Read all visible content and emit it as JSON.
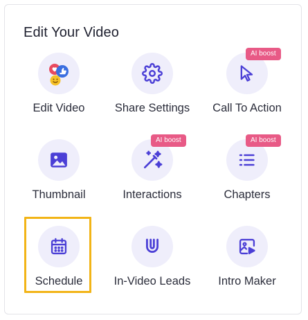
{
  "panel": {
    "title": "Edit Your Video"
  },
  "colors": {
    "accent": "#4b3fd6",
    "icon_bg": "#efeefb",
    "badge": "#e85a86",
    "highlight": "#f2b416"
  },
  "tiles": [
    {
      "label": "Edit Video",
      "icon": "emoji-reactions-icon",
      "badge": null
    },
    {
      "label": "Share Settings",
      "icon": "gear-icon",
      "badge": null
    },
    {
      "label": "Call To Action",
      "icon": "cursor-arrow-icon",
      "badge": "AI boost"
    },
    {
      "label": "Thumbnail",
      "icon": "image-icon",
      "badge": null
    },
    {
      "label": "Interactions",
      "icon": "magic-wand-icon",
      "badge": "AI boost"
    },
    {
      "label": "Chapters",
      "icon": "list-icon",
      "badge": "AI boost"
    },
    {
      "label": "Schedule",
      "icon": "calendar-icon",
      "badge": null,
      "selected": true
    },
    {
      "label": "In-Video Leads",
      "icon": "magnet-icon",
      "badge": null
    },
    {
      "label": "Intro Maker",
      "icon": "video-image-icon",
      "badge": null
    }
  ]
}
